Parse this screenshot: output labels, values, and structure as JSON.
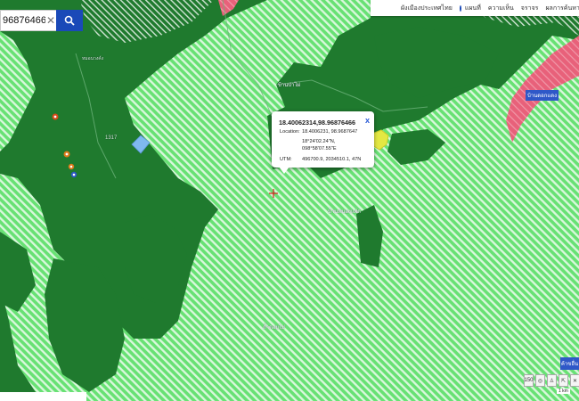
{
  "search": {
    "value": "96876466",
    "clear_glyph": "✕",
    "button_icon": "search-icon"
  },
  "topbar": {
    "items": [
      "ผังเมืองประเทศไทย",
      "แผนที่",
      "ความเห็น",
      "จราจร",
      "ผลการค้นหา"
    ]
  },
  "popup": {
    "title": "18.40062314,98.96876466",
    "close_glyph": "x",
    "location_label": "Location:",
    "location_value": "18.4006231, 98.9687647",
    "dms_lat": "18°24'02.24\"N,",
    "dms_lon": "098°58'07.55\"E",
    "utm_label": "UTM:",
    "utm_value": "496700.9, 2034510.1, 47N"
  },
  "labels": {
    "place1": "บ้านป่าไผ่",
    "place2": "บ้านหนองแฝก",
    "place3": "บ้านดอกแดง",
    "place4": "ถ้ำดอยไม่",
    "road": "1317",
    "top_left": "หมอนวงค์ง"
  },
  "right_tab": "ค้าขอื่น",
  "tools": [
    "150",
    "◎",
    "♙",
    "⇱",
    "✕"
  ],
  "scale": "1 km",
  "colors": {
    "light_green": "#6ee77a",
    "dark_green": "#1f7a2e",
    "pink": "#e8617a",
    "yellow": "#e4e843",
    "blue": "#2f58c8"
  }
}
